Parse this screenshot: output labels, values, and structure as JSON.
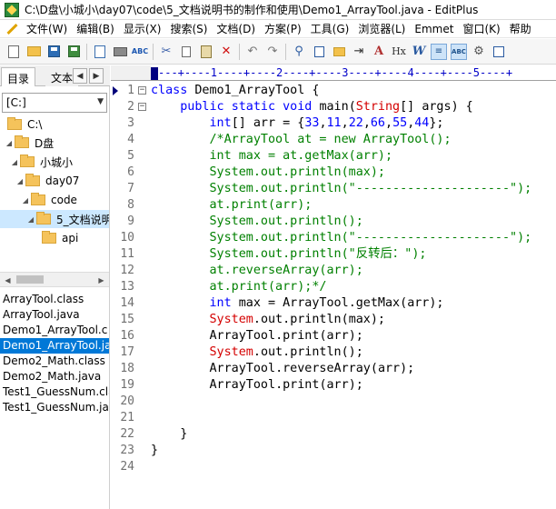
{
  "window": {
    "title": "C:\\D盘\\小城小\\day07\\code\\5_文档说明书的制作和使用\\Demo1_ArrayTool.java - EditPlus"
  },
  "menu": [
    "文件(W)",
    "编辑(B)",
    "显示(X)",
    "搜索(S)",
    "文档(D)",
    "方案(P)",
    "工具(G)",
    "浏览器(L)",
    "Emmet",
    "窗口(K)",
    "帮助"
  ],
  "toolbar": {
    "buttons": [
      "new-file-icon",
      "open-folder-icon",
      "save-icon",
      "save-all-icon",
      "print-preview-icon",
      "print-icon",
      "spell-check-icon",
      "cut-icon",
      "copy-icon",
      "paste-icon",
      "delete-icon",
      "undo-icon",
      "redo-icon",
      "find-icon",
      "replace-icon",
      "find-in-files-icon",
      "goto-icon",
      "font-icon",
      "hex-icon",
      "word-wrap-icon",
      "indent-icon",
      "spell-abc-icon",
      "settings-icon",
      "layout-icon"
    ],
    "labels": {
      "font": "A",
      "hex": "Hx",
      "wrap": "W"
    }
  },
  "sidebar": {
    "tabs": [
      "目录",
      "文本"
    ],
    "drive": "[C:]",
    "tree": [
      {
        "label": "C:\\",
        "depth": 0
      },
      {
        "label": "D盘",
        "depth": 1
      },
      {
        "label": "小城小",
        "depth": 2
      },
      {
        "label": "day07",
        "depth": 3
      },
      {
        "label": "code",
        "depth": 4
      },
      {
        "label": "5_文档说明",
        "depth": 5,
        "selected": true
      },
      {
        "label": "api",
        "depth": 6
      }
    ],
    "files": [
      "ArrayTool.class",
      "ArrayTool.java",
      "Demo1_ArrayTool.c",
      "Demo1_ArrayTool.ja",
      "Demo2_Math.class",
      "Demo2_Math.java",
      "Test1_GuessNum.cla",
      "Test1_GuessNum.ja"
    ],
    "selected_file_index": 3
  },
  "editor": {
    "ruler": "---+----1----+----2----+----3----+----4----+----5----+",
    "lines": [
      {
        "n": "1",
        "text": "class Demo1_ArrayTool {"
      },
      {
        "n": "2",
        "text": "    public static void main(String[] args) {"
      },
      {
        "n": "3",
        "text": "        int[] arr = {33,11,22,66,55,44};"
      },
      {
        "n": "4",
        "text": "        /*ArrayTool at = new ArrayTool();"
      },
      {
        "n": "5",
        "text": "        int max = at.getMax(arr);"
      },
      {
        "n": "6",
        "text": "        System.out.println(max);"
      },
      {
        "n": "7",
        "text": "        System.out.println(\"---------------------\");"
      },
      {
        "n": "8",
        "text": "        at.print(arr);"
      },
      {
        "n": "9",
        "text": "        System.out.println();"
      },
      {
        "n": "10",
        "text": "        System.out.println(\"---------------------\");"
      },
      {
        "n": "11",
        "text": "        System.out.println(\"反转后：\");"
      },
      {
        "n": "12",
        "text": "        at.reverseArray(arr);"
      },
      {
        "n": "13",
        "text": "        at.print(arr);*/"
      },
      {
        "n": "14",
        "text": "        int max = ArrayTool.getMax(arr);"
      },
      {
        "n": "15",
        "text": "        System.out.println(max);"
      },
      {
        "n": "16",
        "text": "        ArrayTool.print(arr);"
      },
      {
        "n": "17",
        "text": "        System.out.println();"
      },
      {
        "n": "18",
        "text": "        ArrayTool.reverseArray(arr);"
      },
      {
        "n": "19",
        "text": "        ArrayTool.print(arr);"
      },
      {
        "n": "20",
        "text": ""
      },
      {
        "n": "21",
        "text": ""
      },
      {
        "n": "22",
        "text": "    }"
      },
      {
        "n": "23",
        "text": "}"
      },
      {
        "n": "24",
        "text": ""
      }
    ]
  },
  "colors": {
    "keyword": "#0000ff",
    "class": "#d40000",
    "string": "#ff00ff",
    "comment": "#008000",
    "selection": "#0078d7"
  }
}
